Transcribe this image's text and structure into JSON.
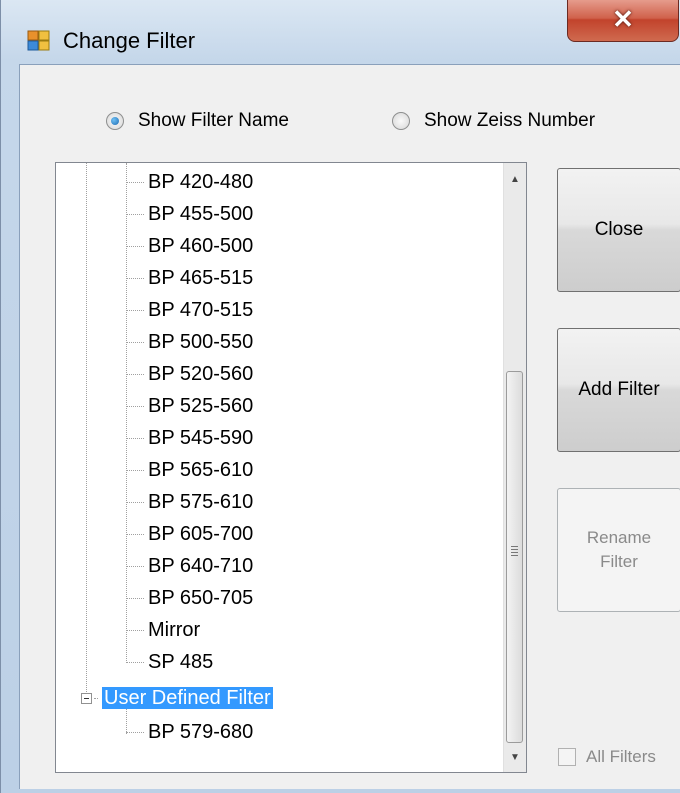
{
  "window": {
    "title": "Change Filter",
    "close_glyph": "✕"
  },
  "options": {
    "show_filter_name": "Show Filter Name",
    "show_zeiss_number": "Show Zeiss Number",
    "selected": "show_filter_name"
  },
  "tree": {
    "filters": [
      "BP 420-480",
      "BP 455-500",
      "BP 460-500",
      "BP 465-515",
      "BP 470-515",
      "BP 500-550",
      "BP 520-560",
      "BP 525-560",
      "BP 545-590",
      "BP 565-610",
      "BP 575-610",
      "BP 605-700",
      "BP 640-710",
      "BP 650-705",
      "Mirror",
      "SP 485"
    ],
    "user_group": "User Defined Filter",
    "user_filters": [
      "BP 579-680"
    ],
    "scroll_up_glyph": "▲",
    "scroll_down_glyph": "▼"
  },
  "buttons": {
    "close": "Close",
    "add_filter": "Add Filter",
    "rename_filter": "Rename Filter"
  },
  "checkbox": {
    "all_filters": "All Filters",
    "checked": false
  }
}
